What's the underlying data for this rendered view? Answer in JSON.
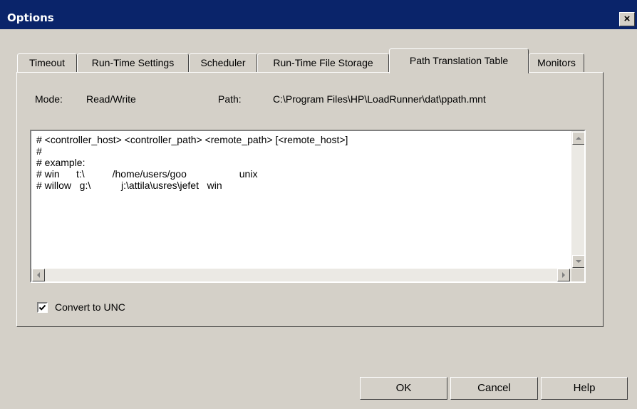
{
  "window": {
    "title": "Options",
    "close_glyph": "×"
  },
  "tabs": [
    {
      "label": "Timeout"
    },
    {
      "label": "Run-Time Settings"
    },
    {
      "label": "Scheduler"
    },
    {
      "label": "Run-Time File Storage"
    },
    {
      "label": "Path Translation Table",
      "active": true
    },
    {
      "label": "Monitors"
    }
  ],
  "info": {
    "mode_label": "Mode:",
    "mode_value": "Read/Write",
    "path_label": "Path:",
    "path_value": "C:\\Program Files\\HP\\LoadRunner\\dat\\ppath.mnt"
  },
  "editor": {
    "content": "# <controller_host> <controller_path> <remote_path> [<remote_host>]\n#\n# example:\n# win      t:\\          /home/users/goo                   unix\n# willow   g:\\           j:\\attila\\usres\\jefet   win"
  },
  "options": {
    "convert_unc_label": "Convert to UNC",
    "convert_unc_checked": true
  },
  "buttons": {
    "ok": "OK",
    "cancel": "Cancel",
    "help": "Help"
  },
  "colors": {
    "titlebar": "#0a246a",
    "face": "#d4d0c8"
  }
}
